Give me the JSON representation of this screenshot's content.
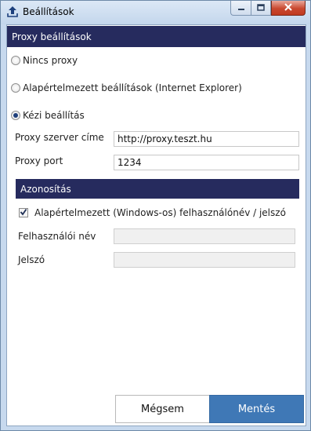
{
  "window": {
    "title": "Beállítások",
    "icon": "upload-arrow-icon",
    "controls": [
      "minimize-icon",
      "maximize-icon",
      "close-icon"
    ]
  },
  "proxy": {
    "section_title": "Proxy beállítások",
    "options": [
      {
        "label": "Nincs proxy",
        "selected": false
      },
      {
        "label": "Alapértelmezett beállítások (Internet Explorer)",
        "selected": false
      },
      {
        "label": "Kézi beállítás",
        "selected": true
      }
    ],
    "server": {
      "label": "Proxy szerver címe",
      "value": "http://proxy.teszt.hu"
    },
    "port": {
      "label": "Proxy port",
      "value": "1234"
    }
  },
  "auth": {
    "section_title": "Azonosítás",
    "default_credentials": {
      "label": "Alapértelmezett (Windows-os) felhasználónév / jelszó",
      "checked": true
    },
    "username": {
      "label": "Felhasználói név",
      "value": ""
    },
    "password": {
      "label": "Jelszó",
      "value": ""
    }
  },
  "buttons": {
    "cancel": "Mégsem",
    "save": "Mentés"
  },
  "colors": {
    "header_bg": "#262b5e",
    "save_bg": "#3f78b6",
    "window_frame": "#c7d9ee"
  }
}
